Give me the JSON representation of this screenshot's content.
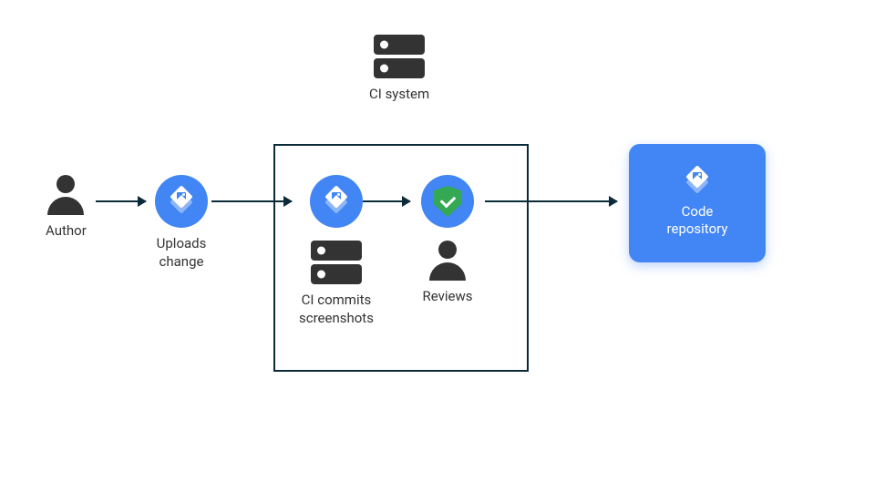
{
  "author": {
    "label": "Author"
  },
  "uploads": {
    "label": "Uploads\nchange"
  },
  "ci_system": {
    "label": "CI system"
  },
  "ci_commits": {
    "label": "CI commits\nscreenshots"
  },
  "reviews": {
    "label": "Reviews"
  },
  "repo": {
    "label": "Code\nrepository"
  },
  "colors": {
    "blue": "#4285F4",
    "green": "#34A853",
    "dark": "#333333",
    "stroke": "#0b2a3a"
  }
}
